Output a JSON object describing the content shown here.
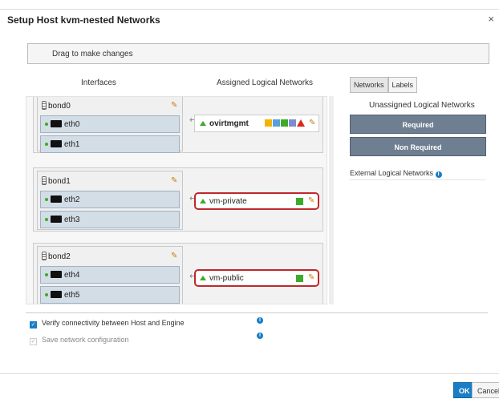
{
  "dialog": {
    "title": "Setup Host kvm-nested Networks",
    "close_glyph": "×",
    "hint": "Drag to make changes"
  },
  "columns": {
    "interfaces": "Interfaces",
    "assigned": "Assigned Logical Networks"
  },
  "groups": [
    {
      "bond": "bond0",
      "nics": [
        "eth0",
        "eth1"
      ],
      "network": "ovirtmgmt",
      "network_bold": true,
      "highlighted": false,
      "status_icons": [
        "vm-icon",
        "display-icon",
        "migration-icon",
        "gluster-icon",
        "warning-icon"
      ]
    },
    {
      "bond": "bond1",
      "nics": [
        "eth2",
        "eth3"
      ],
      "network": "vm-private",
      "network_bold": false,
      "highlighted": true,
      "status_icons": [
        "vm-icon"
      ]
    },
    {
      "bond": "bond2",
      "nics": [
        "eth4",
        "eth5"
      ],
      "network": "vm-public",
      "network_bold": false,
      "highlighted": true,
      "status_icons": [
        "vm-icon"
      ]
    }
  ],
  "right_panel": {
    "tabs": [
      "Networks",
      "Labels"
    ],
    "unassigned_title": "Unassigned Logical Networks",
    "required": "Required",
    "non_required": "Non Required",
    "external": "External Logical Networks"
  },
  "options": {
    "verify": "Verify connectivity between Host and Engine",
    "save": "Save network configuration"
  },
  "buttons": {
    "ok": "OK",
    "cancel": "Cancel"
  },
  "colors": {
    "accent": "#1a7dc6",
    "highlight": "#c0282b",
    "up_status": "#3cab2a",
    "category_bar": "#6e7f91"
  }
}
